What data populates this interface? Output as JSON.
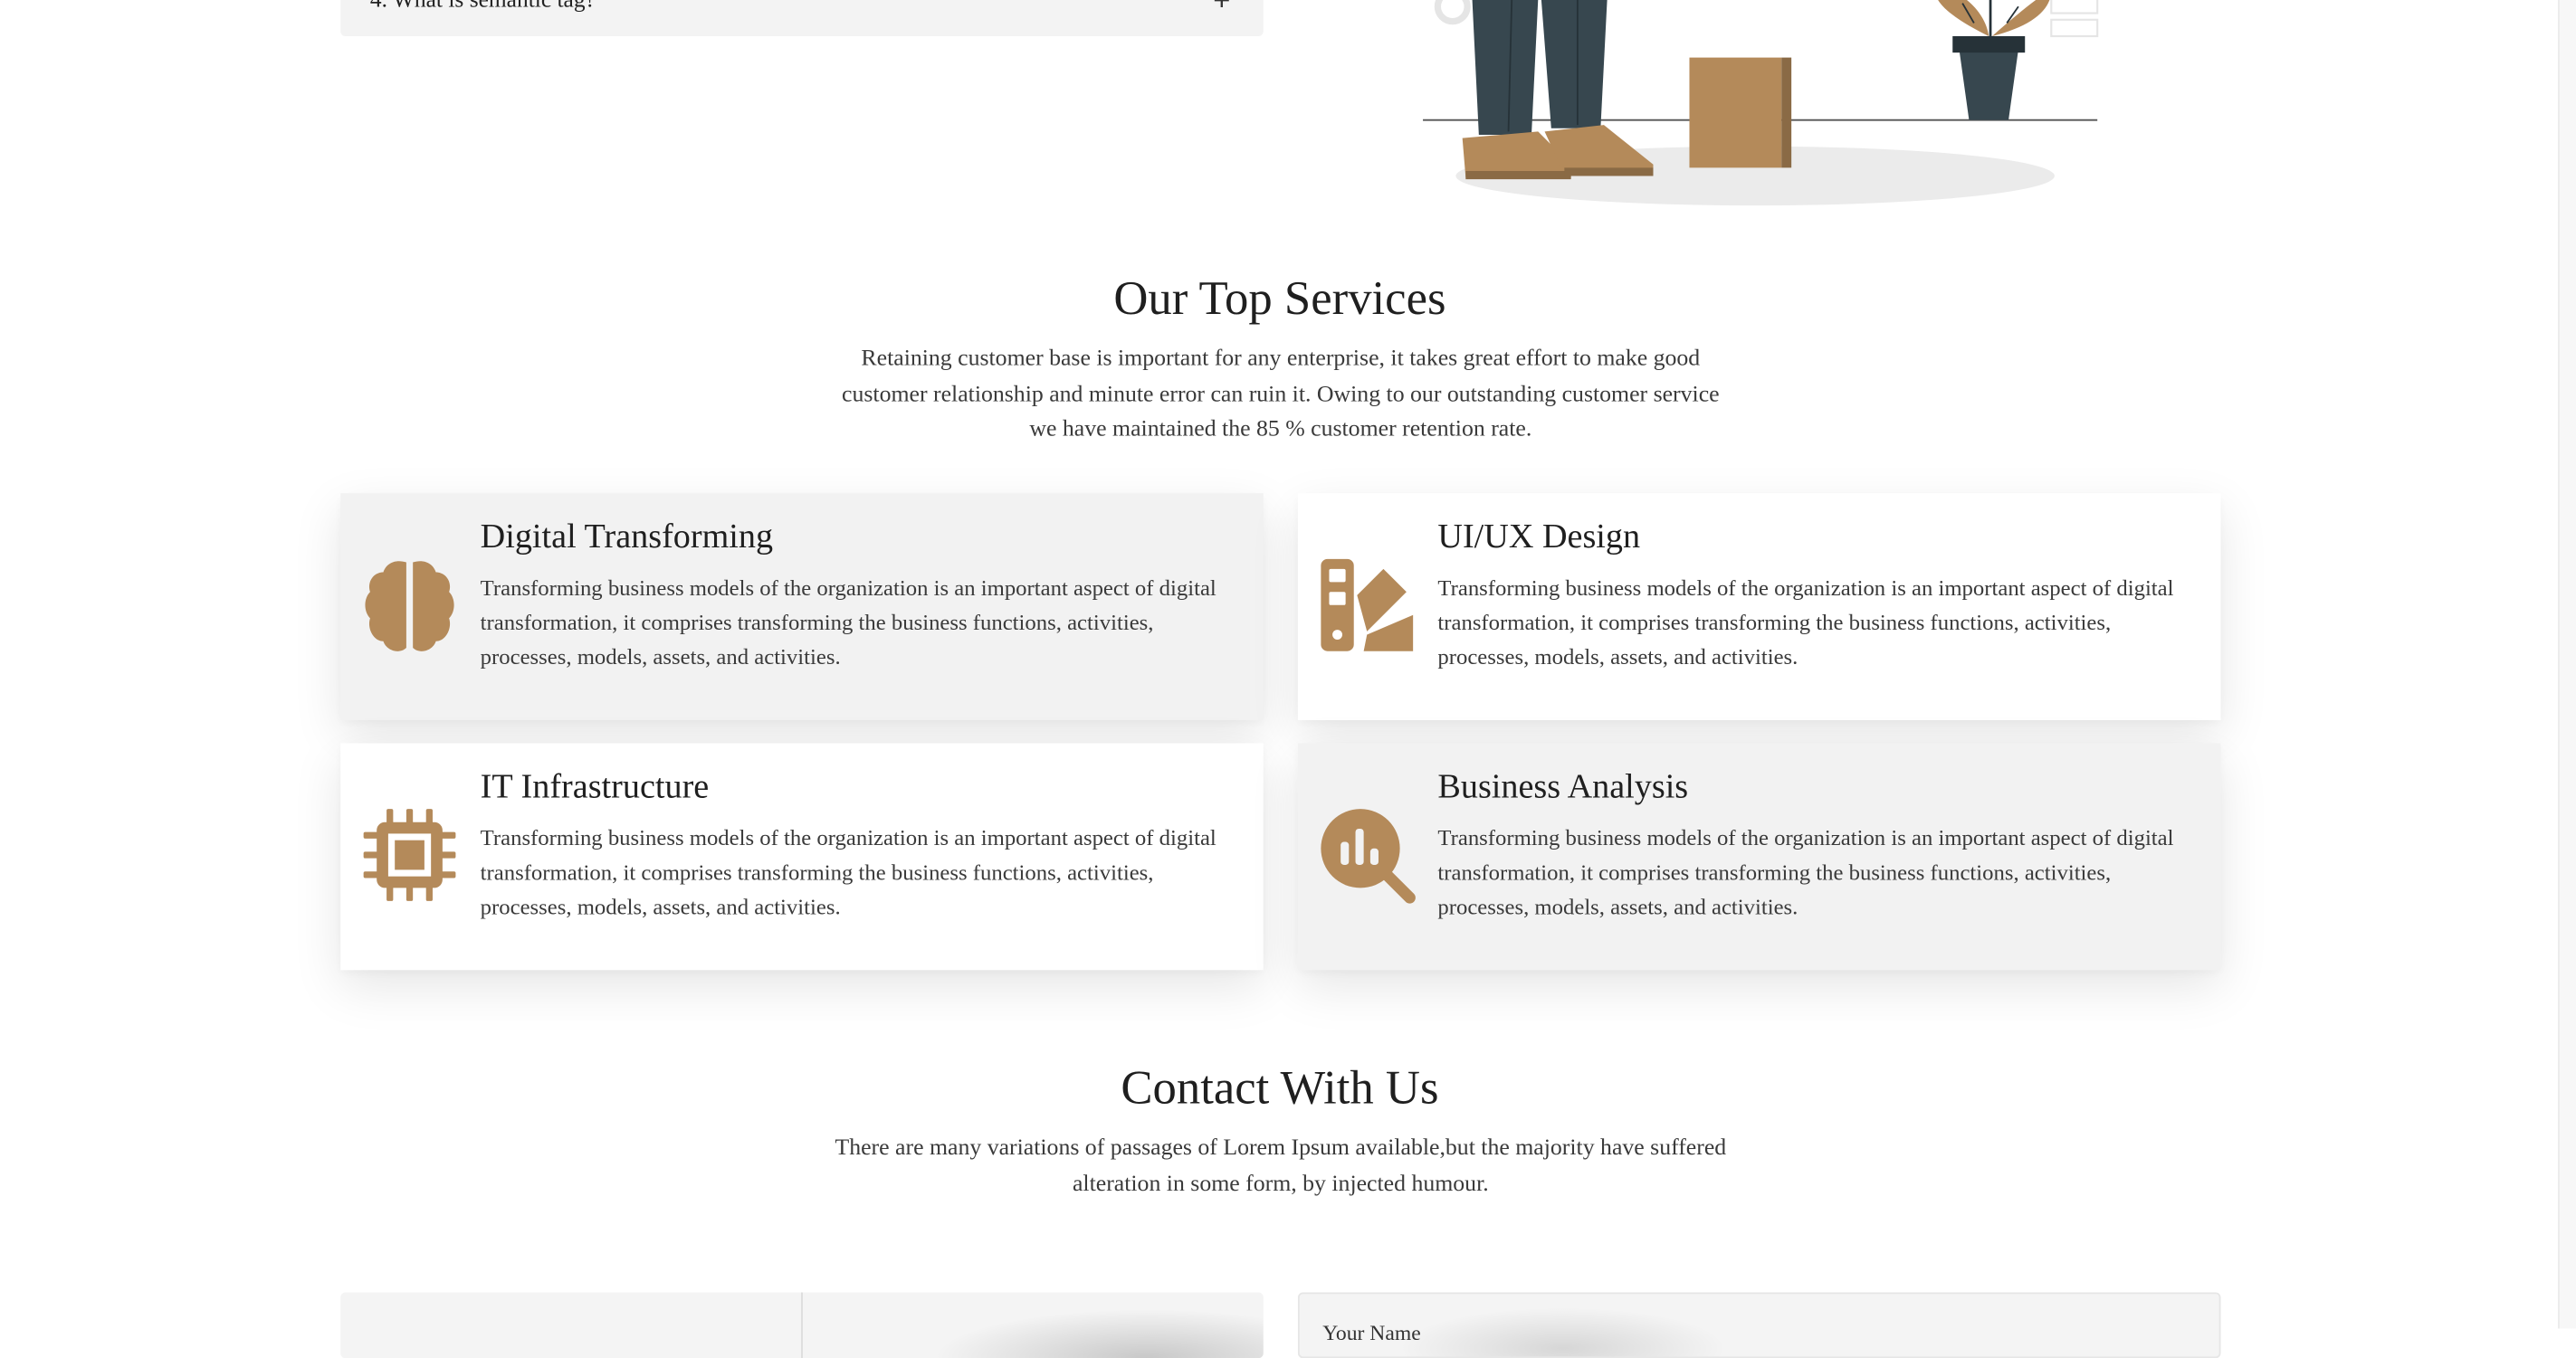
{
  "faq": {
    "question": "4. What is semantic tag?",
    "toggle": "+"
  },
  "services": {
    "title": "Our Top Services",
    "description": "Retaining customer base is important for any enterprise, it takes great effort to make good customer relationship and minute error can ruin it. Owing to our outstanding customer service we have maintained the 85 % customer retention rate.",
    "accent_color": "#b48a5a",
    "items": [
      {
        "title": "Digital Transforming",
        "icon": "brain-icon",
        "text": "Transforming business models of the organization is an important aspect of digital transformation, it comprises transforming the business functions, activities, processes, models, assets, and activities."
      },
      {
        "title": "UI/UX Design",
        "icon": "swatchbook-icon",
        "text": "Transforming business models of the organization is an important aspect of digital transformation, it comprises transforming the business functions, activities, processes, models, assets, and activities."
      },
      {
        "title": "IT Infrastructure",
        "icon": "microchip-icon",
        "text": "Transforming business models of the organization is an important aspect of digital transformation, it comprises transforming the business functions, activities, processes, models, assets, and activities."
      },
      {
        "title": "Business Analysis",
        "icon": "magnifying-chart-icon",
        "text": "Transforming business models of the organization is an important aspect of digital transformation, it comprises transforming the business functions, activities, processes, models, assets, and activities."
      }
    ]
  },
  "contact": {
    "title": "Contact With Us",
    "description": "There are many variations of passages of Lorem Ipsum available,but the majority have suffered alteration in some form, by injected humour.",
    "form_first_label": "Your Name"
  }
}
